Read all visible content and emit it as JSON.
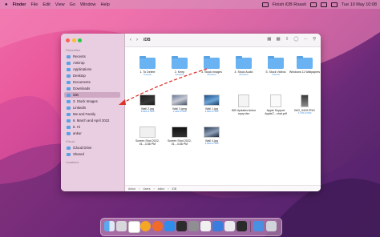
{
  "menubar": {
    "apple_icon": "apple-icon",
    "app_name": "Finder",
    "menus": [
      "File",
      "Edit",
      "View",
      "Go",
      "Window",
      "Help"
    ],
    "status_app": "Finish iDB Roasti",
    "datetime": "Tue 10 May 10:08"
  },
  "window": {
    "title": "iDB",
    "sidebar": {
      "favourites_header": "Favourites",
      "favourites": [
        "Recents",
        "AirDrop",
        "Applications",
        "Desktop",
        "Documents",
        "Downloads",
        "iDB",
        "3. Stock Images",
        "LinkedIn",
        "Me and Family",
        "6. March and April 2022",
        "5. Hi",
        "ankur"
      ],
      "icloud_header": "iCloud",
      "icloud": [
        "iCloud Drive",
        "Shared"
      ],
      "locations_header": "Locations"
    },
    "files": [
      {
        "name": "1. To Delete",
        "sub": "6 items",
        "kind": "folder"
      },
      {
        "name": "2. Keep",
        "sub": "14 items",
        "kind": "folder"
      },
      {
        "name": "3. Stock Images",
        "sub": "20 items",
        "kind": "folder"
      },
      {
        "name": "4. Stock Audio",
        "sub": "24 items",
        "kind": "folder"
      },
      {
        "name": "5. Stock Videos",
        "sub": "4 items",
        "kind": "folder"
      },
      {
        "name": "Windows 11 Wallpapers",
        "sub": "",
        "kind": "folder"
      },
      {
        "name": "Wall 2.jpg",
        "sub": "3,840×1,920",
        "kind": "image"
      },
      {
        "name": "Wall 3.jpeg",
        "sub": "1,920×1,080",
        "kind": "image"
      },
      {
        "name": "Wall 1.jpg",
        "sub": "3,840×2,160",
        "kind": "image"
      },
      {
        "name": "iDB Updates Ankur copy.xlsx",
        "sub": "",
        "kind": "doc"
      },
      {
        "name": "Apple Support AppleC...chat.pdf",
        "sub": "",
        "kind": "doc"
      },
      {
        "name": "IMG_9429.PNG",
        "sub": "1,170×2,532",
        "kind": "image"
      },
      {
        "name": "Screen Shot 2022-01...3.58 PM",
        "sub": "",
        "kind": "image"
      },
      {
        "name": "Screen Shot 2022-01...4.58 PM",
        "sub": "",
        "kind": "image"
      },
      {
        "name": "Wall 4.jpg",
        "sub": "3,840×2,160",
        "kind": "image"
      }
    ],
    "pathbar": [
      "Ankur",
      "Users",
      "ankur",
      "iDB"
    ]
  },
  "colors": {
    "accent": "#69b3f2",
    "sidebar_bg": "#e9cde1",
    "arrow": "#e0302a"
  }
}
